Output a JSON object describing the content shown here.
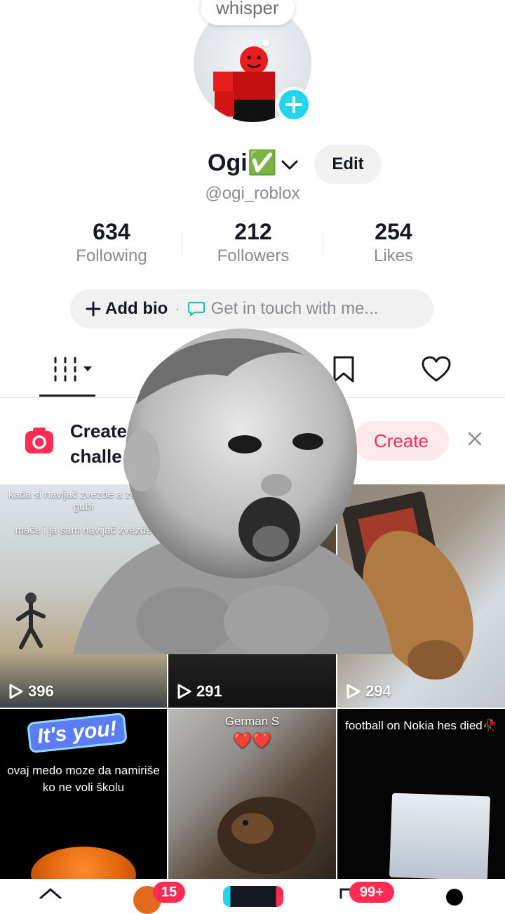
{
  "profile": {
    "whisper": "whisper",
    "display_name": "Ogi✅",
    "username": "@ogi_roblox",
    "edit_label": "Edit"
  },
  "stats": [
    {
      "value": "634",
      "label": "Following"
    },
    {
      "value": "212",
      "label": "Followers"
    },
    {
      "value": "254",
      "label": "Likes"
    }
  ],
  "bio": {
    "add_label": "Add bio",
    "separator": "·",
    "contact_label": "Get in touch with me..."
  },
  "tabs": {
    "icons": [
      "grid-icon",
      "lock-icon",
      "bookmark-icon",
      "heart-icon"
    ]
  },
  "banner": {
    "line1": "Create",
    "line2": "challe",
    "create_label": "Create"
  },
  "videos": [
    {
      "views": "396",
      "caption": "kada si navijač zvezde a zvezda gubi\n\nmače i ja sam navijač zvezde"
    },
    {
      "views": "291",
      "caption": ""
    },
    {
      "views": "294",
      "caption": ""
    },
    {
      "views": "",
      "caption_sticker": "It's you!",
      "caption": "ovaj medo moze da namiriše ko ne voli školu"
    },
    {
      "views": "",
      "caption": "German S",
      "hearts": "❤️❤️"
    },
    {
      "views": "",
      "caption": "football on Nokia hes died🥀"
    }
  ],
  "nav": {
    "friends_badge": "15",
    "inbox_badge": "99+"
  },
  "colors": {
    "accent": "#fe2c55",
    "cyan": "#20d5ec",
    "text": "#161823",
    "secondary": "#8a8b91"
  }
}
